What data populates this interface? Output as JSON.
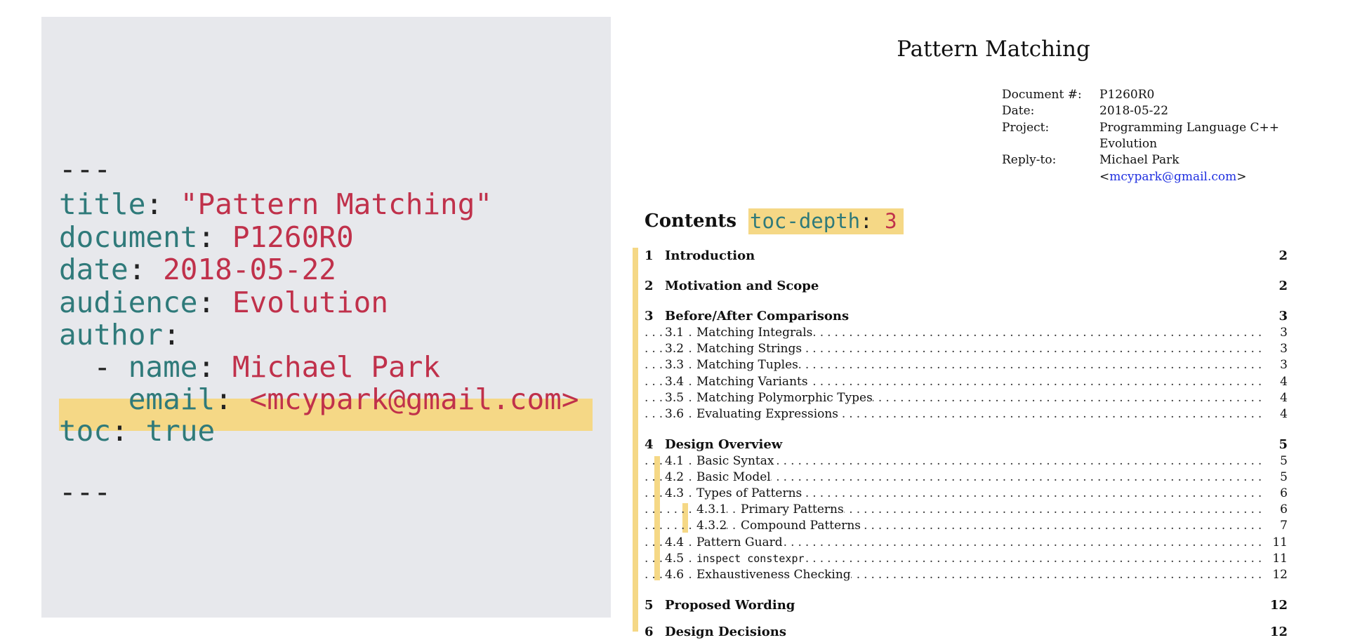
{
  "yaml": {
    "open_fence": "---",
    "title_key": "title",
    "title_value": "\"Pattern Matching\"",
    "document_key": "document",
    "document_value": "P1260R0",
    "date_key": "date",
    "date_value": "2018-05-22",
    "audience_key": "audience",
    "audience_value": "Evolution",
    "author_key": "author",
    "name_dash": "- ",
    "name_key": "name",
    "name_value": "Michael Park",
    "email_key": "email",
    "email_value": "<mcypark@gmail.com>",
    "toc_key": "toc",
    "toc_value": "true",
    "close_fence": "---",
    "colon": ":"
  },
  "doc": {
    "title": "Pattern Matching",
    "meta": {
      "document_label": "Document #:",
      "document_value": "P1260R0",
      "date_label": "Date:",
      "date_value": "2018-05-22",
      "project_label": "Project:",
      "project_value_line1": "Programming Language C++",
      "project_value_line2": "Evolution",
      "reply_label": "Reply-to:",
      "reply_name": "Michael Park",
      "reply_email_open": "<",
      "reply_email": "mcypark@gmail.com",
      "reply_email_close": ">"
    },
    "contents_heading": "Contents",
    "toc_depth_key": "toc-depth",
    "toc_depth_colon": ":",
    "toc_depth_value": "3",
    "toc": [
      {
        "num": "1",
        "title": "Introduction",
        "page": "2"
      },
      {
        "num": "2",
        "title": "Motivation and Scope",
        "page": "2"
      },
      {
        "num": "3",
        "title": "Before/After Comparisons",
        "page": "3"
      },
      {
        "num": "3.1",
        "title": "Matching Integrals",
        "page": "3"
      },
      {
        "num": "3.2",
        "title": "Matching Strings",
        "page": "3"
      },
      {
        "num": "3.3",
        "title": "Matching Tuples",
        "page": "3"
      },
      {
        "num": "3.4",
        "title": "Matching Variants",
        "page": "4"
      },
      {
        "num": "3.5",
        "title": "Matching Polymorphic Types",
        "page": "4"
      },
      {
        "num": "3.6",
        "title": "Evaluating Expressions",
        "page": "4"
      },
      {
        "num": "4",
        "title": "Design Overview",
        "page": "5"
      },
      {
        "num": "4.1",
        "title": "Basic Syntax",
        "page": "5"
      },
      {
        "num": "4.2",
        "title": "Basic Model",
        "page": "5"
      },
      {
        "num": "4.3",
        "title": "Types of Patterns",
        "page": "6"
      },
      {
        "num": "4.3.1",
        "title": "Primary Patterns",
        "page": "6"
      },
      {
        "num": "4.3.2",
        "title": "Compound Patterns",
        "page": "7"
      },
      {
        "num": "4.4",
        "title": "Pattern Guard",
        "page": "11"
      },
      {
        "num": "4.5",
        "title": "inspect constexpr",
        "page": "11"
      },
      {
        "num": "4.6",
        "title": "Exhaustiveness Checking",
        "page": "12"
      },
      {
        "num": "5",
        "title": "Proposed Wording",
        "page": "12"
      },
      {
        "num": "6",
        "title": "Design Decisions",
        "page": "12"
      }
    ]
  }
}
